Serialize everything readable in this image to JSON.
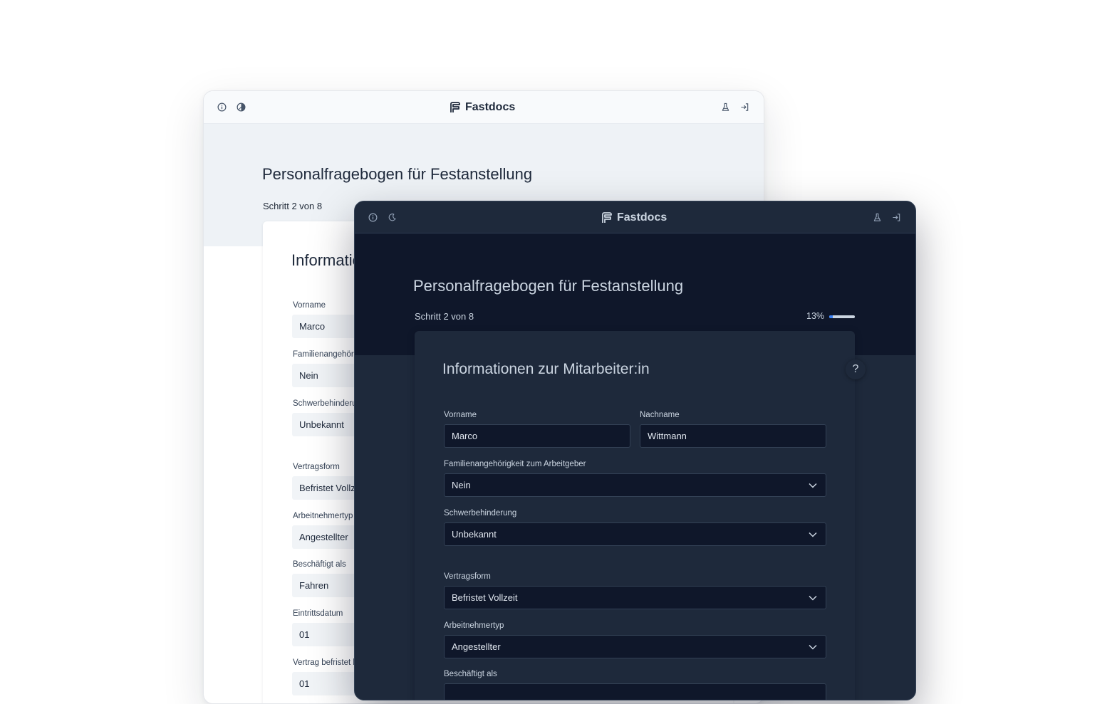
{
  "light_window": {
    "brand": "Fastdocs",
    "form_title": "Personalfragebogen für Festanstellung",
    "step_text": "Schritt 2 von 8",
    "card_title": "Informationen zur Mitarbeiter:in",
    "fields": {
      "vorname_label": "Vorname",
      "vorname_value": "Marco",
      "familie_label": "Familienangehörigkeit zum Arbeitgeber",
      "familie_value": "Nein",
      "schwer_label": "Schwerbehinderung",
      "schwer_value": "Unbekannt",
      "vertrag_label": "Vertragsform",
      "vertrag_value": "Befristet Vollzeit",
      "typ_label": "Arbeitnehmertyp",
      "typ_value": "Angestellter",
      "besch_label": "Beschäftigt als",
      "besch_value": "Fahren",
      "eintritt_label": "Eintrittsdatum",
      "eintritt_value": "01",
      "befristet_label": "Vertrag befristet bis",
      "befristet_value": "01"
    },
    "icons": [
      "info-icon",
      "contrast-icon",
      "flask-icon",
      "login-icon"
    ]
  },
  "dark_window": {
    "brand": "Fastdocs",
    "form_title": "Personalfragebogen für Festanstellung",
    "step_text": "Schritt 2 von 8",
    "progress_label": "13%",
    "progress_fraction": 0.13,
    "card_title": "Informationen zur Mitarbeiter:in",
    "help_label": "?",
    "fields": {
      "vorname_label": "Vorname",
      "vorname_value": "Marco",
      "nachname_label": "Nachname",
      "nachname_value": "Wittmann",
      "familie_label": "Familienangehörigkeit zum Arbeitgeber",
      "familie_value": "Nein",
      "schwer_label": "Schwerbehinderung",
      "schwer_value": "Unbekannt",
      "vertrag_label": "Vertragsform",
      "vertrag_value": "Befristet Vollzeit",
      "typ_label": "Arbeitnehmertyp",
      "typ_value": "Angestellter",
      "besch_label": "Beschäftigt als"
    },
    "icons": [
      "info-icon",
      "moon-icon",
      "flask-icon",
      "login-icon",
      "chevron-down-icon"
    ]
  },
  "colors": {
    "light_bg": "#eef2f6",
    "dark_bg": "#0f172a",
    "dark_surface": "#1e293b",
    "accent": "#3b82f6"
  }
}
